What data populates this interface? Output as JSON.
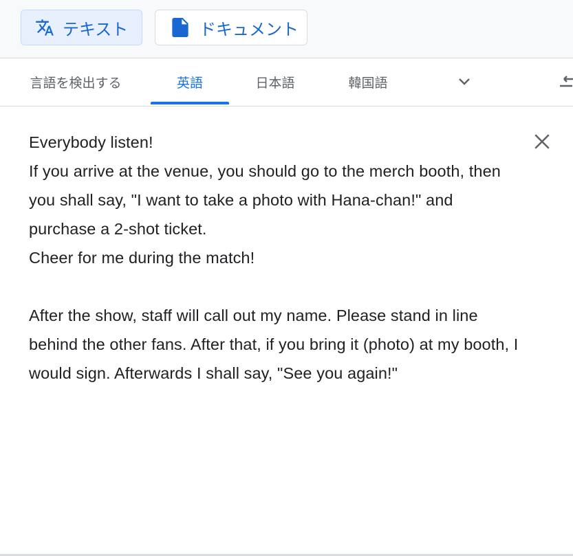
{
  "modes": {
    "text_label": "テキスト",
    "document_label": "ドキュメント",
    "text_icon": "translate-icon",
    "document_icon": "document-icon"
  },
  "languages": {
    "tabs": [
      {
        "label": "言語を検出する",
        "active": false
      },
      {
        "label": "英語",
        "active": true
      },
      {
        "label": "日本語",
        "active": false
      },
      {
        "label": "韓国語",
        "active": false
      }
    ],
    "more_icon": "chevron-down-icon",
    "swap_icon": "swap-icon"
  },
  "source": {
    "text": "Everybody listen!\nIf you arrive at the venue, you should go to the merch booth, then you shall say, \"I want to take a photo with Hana-chan!\" and purchase a 2-shot ticket.\nCheer for me during the match!\n\nAfter the show, staff will call out my name. Please stand in line behind the other fans. After that, if you bring it (photo) at my booth, I would sign. Afterwards I shall say, \"See you again!\"",
    "clear_icon": "close-icon"
  },
  "colors": {
    "accent": "#1a73e8",
    "active_bg": "#e8f0fe",
    "muted_text": "#5f6368",
    "divider": "#dadce0"
  }
}
